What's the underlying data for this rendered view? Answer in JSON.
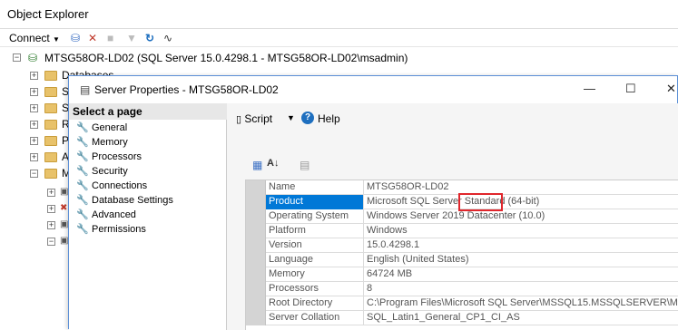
{
  "object_explorer": {
    "title": "Object Explorer",
    "toolbar": {
      "connect_label": "Connect"
    },
    "server_node": "MTSG58OR-LD02 (SQL Server 15.0.4298.1 - MTSG58OR-LD02\\msadmin)",
    "first_child": "Databases",
    "child_initials": [
      "S",
      "S",
      "R",
      "P",
      "A",
      "M"
    ]
  },
  "dialog": {
    "title": "Server Properties - MTSG58OR-LD02",
    "select_page_header": "Select a page",
    "pages": [
      "General",
      "Memory",
      "Processors",
      "Security",
      "Connections",
      "Database Settings",
      "Advanced",
      "Permissions"
    ],
    "selected_page": "General",
    "toolbar": {
      "script_label": "Script",
      "help_label": "Help"
    },
    "properties": [
      {
        "name": "Name",
        "value": "MTSG58OR-LD02"
      },
      {
        "name": "Product",
        "value": "Microsoft SQL Server Standard (64-bit)"
      },
      {
        "name": "Operating System",
        "value": "Windows Server 2019 Datacenter (10.0)"
      },
      {
        "name": "Platform",
        "value": "Windows"
      },
      {
        "name": "Version",
        "value": "15.0.4298.1"
      },
      {
        "name": "Language",
        "value": "English (United States)"
      },
      {
        "name": "Memory",
        "value": "64724 MB"
      },
      {
        "name": "Processors",
        "value": "8"
      },
      {
        "name": "Root Directory",
        "value": "C:\\Program Files\\Microsoft SQL Server\\MSSQL15.MSSQLSERVER\\M"
      },
      {
        "name": "Server Collation",
        "value": "SQL_Latin1_General_CP1_CI_AS"
      }
    ],
    "selected_property": "Product"
  }
}
